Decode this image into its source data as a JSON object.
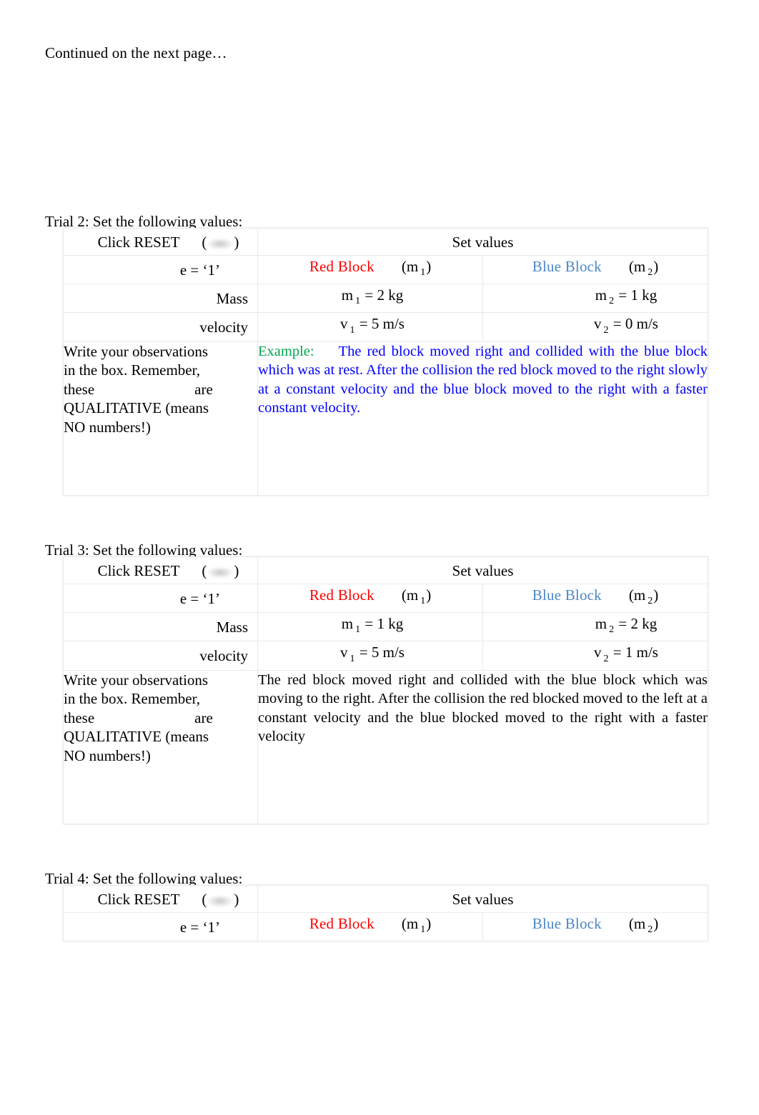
{
  "document": {
    "continued_note": "Continued on the next page…"
  },
  "labels": {
    "click_reset_prefix": "Click RESET",
    "paren_open": "(",
    "paren_close": ")",
    "reset_button_icon": "blurred-reset-button-image",
    "set_values": "Set values",
    "e_value": "e = ‘1’",
    "red_block": "Red Block",
    "blue_block": "Blue Block",
    "m1_paren": "(m",
    "m2_paren": "(m",
    "sub1": "1",
    "sub2": "2",
    "paren_end": ")",
    "mass": "Mass",
    "velocity": "velocity",
    "instructions_line1": "Write your observations",
    "instructions_line2": "in the box. Remember,",
    "instructions_line3a": "these",
    "instructions_line3b": "are",
    "instructions_line4": "QUALITATIVE  (means",
    "instructions_line5": "NO numbers!)"
  },
  "trials": [
    {
      "id": "trial-2",
      "heading": "Trial 2: Set the following values:",
      "mass_red": "m",
      "mass_red_sub": "1",
      "mass_red_value": " = 2 kg",
      "mass_blue": "m",
      "mass_blue_sub": "2",
      "mass_blue_value": " = 1 kg",
      "vel_red": "v",
      "vel_red_sub": "1",
      "vel_red_value": " = 5 m/s",
      "vel_blue": "v",
      "vel_blue_sub": "2",
      "vel_blue_value": " = 0 m/s",
      "observation_kind": "example",
      "observation_lead": "Example:",
      "observation_body": "The red block moved right and collided with the blue block which was at rest. After the collision the red block moved to the right slowly at a constant velocity and the blue block moved to the right with a faster constant velocity.",
      "truncated": false
    },
    {
      "id": "trial-3",
      "heading": "Trial 3: Set the following values:",
      "mass_red": "m",
      "mass_red_sub": "1",
      "mass_red_value": " = 1 kg",
      "mass_blue": "m",
      "mass_blue_sub": "2",
      "mass_blue_value": " = 2 kg",
      "vel_red": "v",
      "vel_red_sub": "1",
      "vel_red_value": " = 5 m/s",
      "vel_blue": "v",
      "vel_blue_sub": "2",
      "vel_blue_value": " = 1 m/s",
      "observation_kind": "plain",
      "observation_lead": "",
      "observation_body": "The red block moved right and collided with the blue block which was moving to the right. After the collision the red blocked moved to the left at a constant velocity and the blue blocked moved to the right with a faster velocity",
      "truncated": false
    },
    {
      "id": "trial-4",
      "heading": "Trial 4: Set the following values:",
      "truncated": true
    }
  ],
  "colors": {
    "red_block": "#ff0000",
    "blue_block": "#4a86c8",
    "example_lead": "#00a550",
    "example_body": "#0000ff",
    "text": "#000000",
    "table_border": "#e9e9e9"
  }
}
